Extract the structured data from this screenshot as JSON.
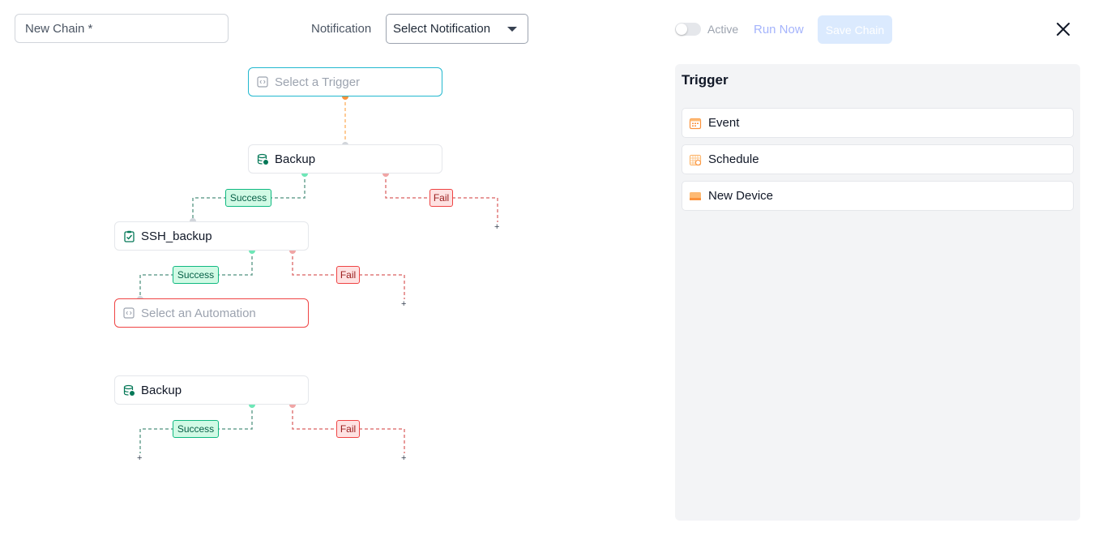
{
  "header": {
    "chain_name_placeholder": "New Chain *",
    "notification_label": "Notification",
    "notification_value": "Select Notification",
    "active_label": "Active",
    "run_now_label": "Run Now",
    "save_label": "Save Chain"
  },
  "canvas": {
    "trigger_node": "Select a Trigger",
    "backup_node_1": "Backup",
    "ssh_node": "SSH_backup",
    "automation_node": "Select an Automation",
    "backup_node_2": "Backup",
    "success_label": "Success",
    "fail_label": "Fail",
    "plus": "+"
  },
  "panel": {
    "title": "Trigger",
    "items": [
      {
        "label": "Event",
        "icon": "calendar-icon"
      },
      {
        "label": "Schedule",
        "icon": "schedule-icon"
      },
      {
        "label": "New Device",
        "icon": "device-icon"
      }
    ]
  },
  "colors": {
    "success": "#10b981",
    "fail": "#ef4444",
    "trigger_link": "#fdba74",
    "trigger_border": "#22b8cf",
    "accent_orange": "#fb923c"
  }
}
